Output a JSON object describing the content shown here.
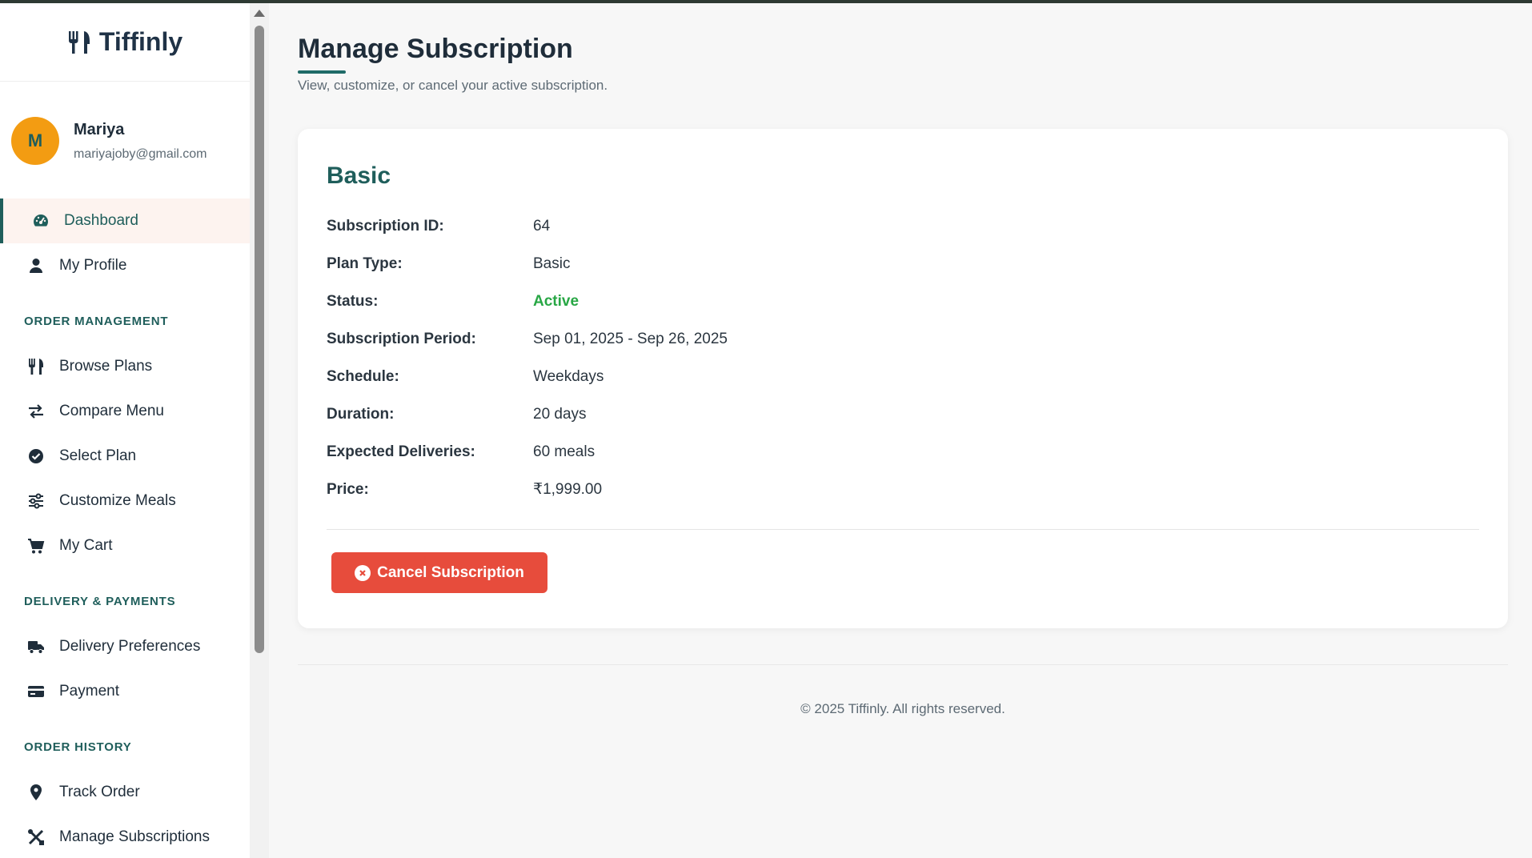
{
  "app": {
    "name": "Tiffinly"
  },
  "user": {
    "initial": "M",
    "name": "Mariya",
    "email": "mariyajoby@gmail.com"
  },
  "nav": {
    "dashboard": "Dashboard",
    "profile": "My Profile",
    "heading_order": "ORDER MANAGEMENT",
    "browse_plans": "Browse Plans",
    "compare_menu": "Compare Menu",
    "select_plan": "Select Plan",
    "customize_meals": "Customize Meals",
    "my_cart": "My Cart",
    "heading_delivery": "DELIVERY & PAYMENTS",
    "delivery_preferences": "Delivery Preferences",
    "payment": "Payment",
    "heading_history": "ORDER HISTORY",
    "track_order": "Track Order",
    "manage_subscriptions": "Manage Subscriptions"
  },
  "page": {
    "title": "Manage Subscription",
    "subtitle": "View, customize, or cancel your active subscription."
  },
  "subscription": {
    "plan_name": "Basic",
    "details": [
      {
        "label": "Subscription ID:",
        "value": "64"
      },
      {
        "label": "Plan Type:",
        "value": "Basic"
      },
      {
        "label": "Status:",
        "value": "Active"
      },
      {
        "label": "Subscription Period:",
        "value": "Sep 01, 2025 - Sep 26, 2025"
      },
      {
        "label": "Schedule:",
        "value": "Weekdays"
      },
      {
        "label": "Duration:",
        "value": "20 days"
      },
      {
        "label": "Expected Deliveries:",
        "value": "60 meals"
      },
      {
        "label": "Price:",
        "value": "₹1,999.00"
      }
    ],
    "cancel_label": "Cancel Subscription"
  },
  "footer": {
    "text": "© 2025 Tiffinly. All rights reserved."
  },
  "colors": {
    "brand_teal": "#1f5e5b",
    "status_active": "#28a745",
    "danger": "#e74c3c",
    "avatar": "#f39c12"
  }
}
